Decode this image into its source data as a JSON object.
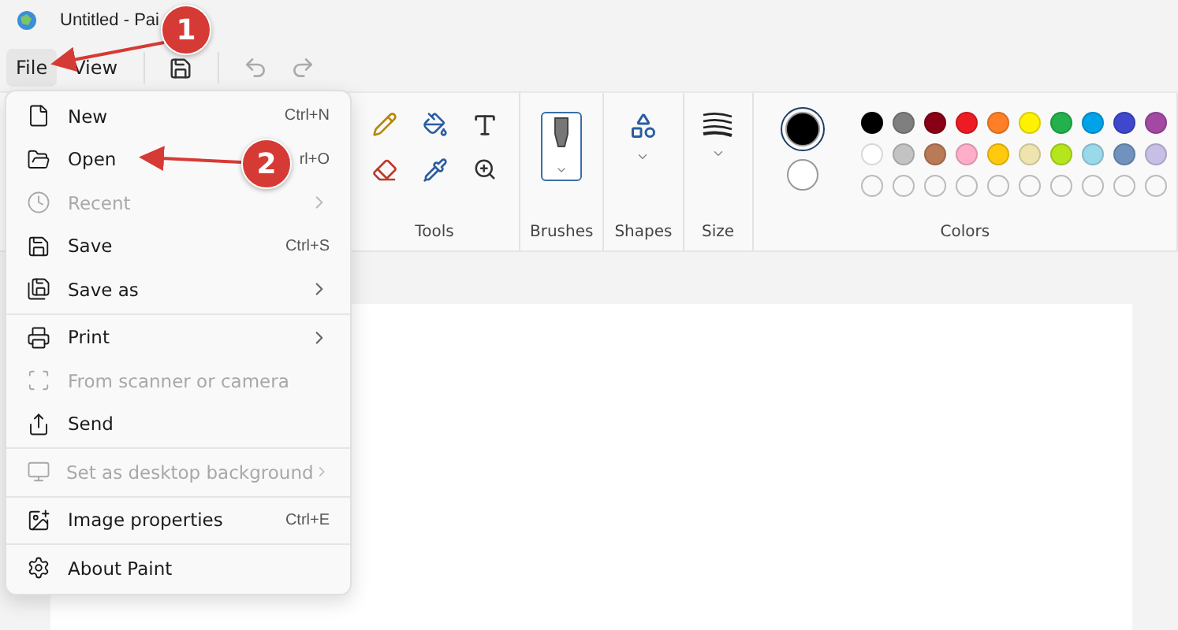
{
  "window": {
    "title": "Untitled - Pai"
  },
  "menu_bar": [
    {
      "label": "File",
      "selected": true
    },
    {
      "label": "View",
      "selected": false
    }
  ],
  "ribbon": {
    "groups": [
      {
        "kind": "tools",
        "label": "Tools"
      },
      {
        "kind": "brushes",
        "label": "Brushes"
      },
      {
        "kind": "shapes",
        "label": "Shapes"
      },
      {
        "kind": "size",
        "label": "Size"
      },
      {
        "kind": "colors",
        "label": "Colors"
      }
    ],
    "current_colors": [
      {
        "color": "#000000",
        "selected": true
      },
      {
        "color": "#ffffff",
        "selected": false
      }
    ],
    "palette": [
      {
        "color": "#000000"
      },
      {
        "color": "#7f7f7f"
      },
      {
        "color": "#880015"
      },
      {
        "color": "#ed1c24"
      },
      {
        "color": "#ff7f27"
      },
      {
        "color": "#fff200"
      },
      {
        "color": "#22b14c"
      },
      {
        "color": "#00a2e8"
      },
      {
        "color": "#3f48cc"
      },
      {
        "color": "#a349a4"
      },
      {
        "color": "#ffffff"
      },
      {
        "color": "#c3c3c3"
      },
      {
        "color": "#b97a57"
      },
      {
        "color": "#ffaec9"
      },
      {
        "color": "#ffc90e"
      },
      {
        "color": "#efe4b0"
      },
      {
        "color": "#b5e61d"
      },
      {
        "color": "#99d9ea"
      },
      {
        "color": "#7092be"
      },
      {
        "color": "#c8bfe7"
      }
    ]
  },
  "file_menu": [
    {
      "kind": "new",
      "label": "New",
      "shortcut": "Ctrl+N",
      "disabled": false,
      "submenu": false
    },
    {
      "kind": "open",
      "label": "Open",
      "shortcut": "rl+O",
      "disabled": false,
      "submenu": false
    },
    {
      "kind": "recent",
      "label": "Recent",
      "disabled": true,
      "submenu": true
    },
    {
      "kind": "save",
      "label": "Save",
      "shortcut": "Ctrl+S",
      "disabled": false,
      "submenu": false
    },
    {
      "kind": "saveas",
      "label": "Save as",
      "disabled": false,
      "submenu": true,
      "divider_after": true
    },
    {
      "kind": "print",
      "label": "Print",
      "disabled": false,
      "submenu": true
    },
    {
      "kind": "scanner",
      "label": "From scanner or camera",
      "disabled": true,
      "submenu": false
    },
    {
      "kind": "send",
      "label": "Send",
      "disabled": false,
      "submenu": false,
      "divider_after": true
    },
    {
      "kind": "background",
      "label": "Set as desktop background",
      "disabled": true,
      "submenu": true,
      "divider_after": true
    },
    {
      "kind": "properties",
      "label": "Image properties",
      "shortcut": "Ctrl+E",
      "disabled": false,
      "submenu": false,
      "divider_after": true
    },
    {
      "kind": "about",
      "label": "About Paint",
      "disabled": false,
      "submenu": false
    }
  ],
  "annotations": [
    {
      "label": "1"
    },
    {
      "label": "2"
    }
  ]
}
